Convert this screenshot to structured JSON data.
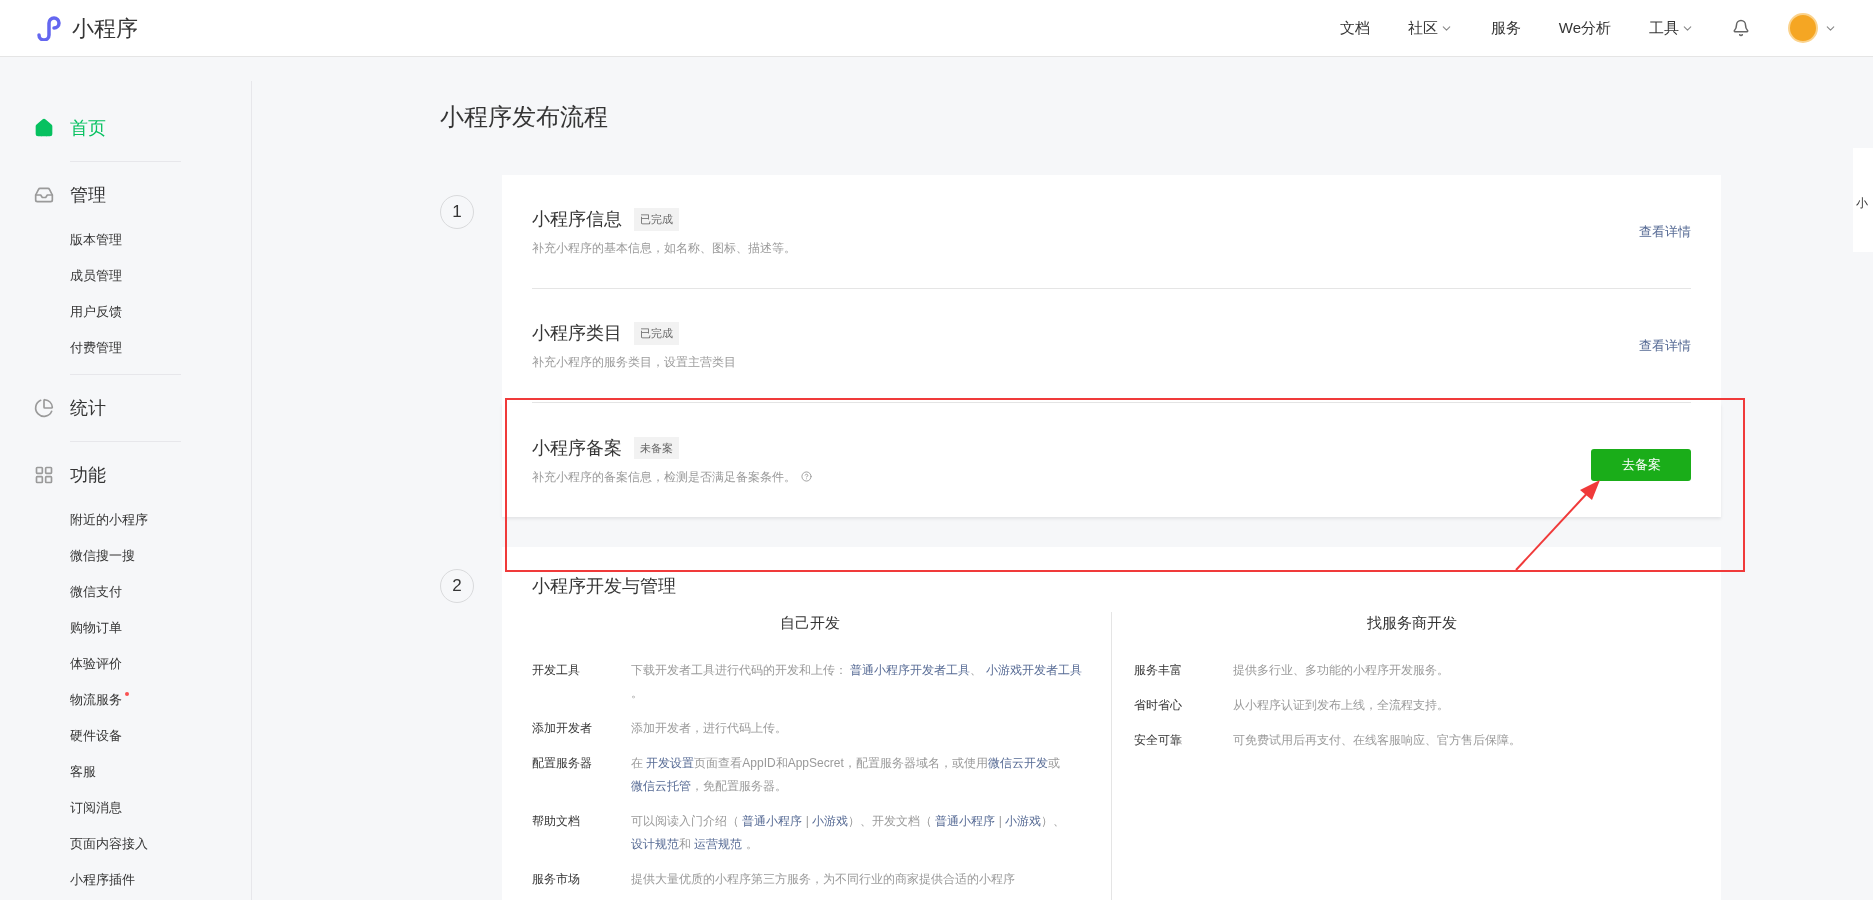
{
  "header": {
    "logo_text": "小程序",
    "nav": [
      {
        "label": "文档",
        "dropdown": false
      },
      {
        "label": "社区",
        "dropdown": true
      },
      {
        "label": "服务",
        "dropdown": false
      },
      {
        "label": "We分析",
        "dropdown": false
      },
      {
        "label": "工具",
        "dropdown": true
      }
    ]
  },
  "sidebar": {
    "sections": [
      {
        "label": "首页",
        "selected": true
      },
      {
        "label": "管理",
        "selected": false,
        "items": [
          {
            "label": "版本管理",
            "badge": false
          },
          {
            "label": "成员管理",
            "badge": false
          },
          {
            "label": "用户反馈",
            "badge": false
          },
          {
            "label": "付费管理",
            "badge": false
          }
        ]
      },
      {
        "label": "统计",
        "selected": false
      },
      {
        "label": "功能",
        "selected": false,
        "items": [
          {
            "label": "附近的小程序",
            "badge": false
          },
          {
            "label": "微信搜一搜",
            "badge": false
          },
          {
            "label": "微信支付",
            "badge": false
          },
          {
            "label": "购物订单",
            "badge": false
          },
          {
            "label": "体验评价",
            "badge": false
          },
          {
            "label": "物流服务",
            "badge": true
          },
          {
            "label": "硬件设备",
            "badge": false
          },
          {
            "label": "客服",
            "badge": false
          },
          {
            "label": "订阅消息",
            "badge": false
          },
          {
            "label": "页面内容接入",
            "badge": false
          },
          {
            "label": "小程序插件",
            "badge": false
          }
        ]
      }
    ]
  },
  "page_title": "小程序发布流程",
  "step1": {
    "number": "1",
    "rows": [
      {
        "title": "小程序信息",
        "status": "已完成",
        "description": "补充小程序的基本信息，如名称、图标、描述等。",
        "help": false,
        "action": {
          "kind": "link",
          "label": "查看详情"
        }
      },
      {
        "title": "小程序类目",
        "status": "已完成",
        "description": "补充小程序的服务类目，设置主营类目",
        "help": false,
        "action": {
          "kind": "link",
          "label": "查看详情"
        }
      },
      {
        "title": "小程序备案",
        "status": "未备案",
        "description": "补充小程序的备案信息，检测是否满足备案条件。",
        "help": true,
        "action": {
          "kind": "button",
          "label": "去备案"
        }
      }
    ]
  },
  "step2": {
    "number": "2",
    "title": "小程序开发与管理",
    "columns": [
      {
        "heading": "自己开发",
        "rows": [
          {
            "label": "开发工具",
            "parts": [
              {
                "kind": "text",
                "text": "下载开发者工具进行代码的开发和上传： "
              },
              {
                "kind": "link",
                "text": "普通小程序开发者工具"
              },
              {
                "kind": "text",
                "text": "、 "
              },
              {
                "kind": "link",
                "text": "小游戏开发者工具"
              },
              {
                "kind": "text",
                "text": " 。"
              }
            ]
          },
          {
            "label": "添加开发者",
            "parts": [
              {
                "kind": "text",
                "text": "添加开发者，进行代码上传。"
              }
            ]
          },
          {
            "label": "配置服务器",
            "parts": [
              {
                "kind": "text",
                "text": "在 "
              },
              {
                "kind": "link",
                "text": "开发设置"
              },
              {
                "kind": "text",
                "text": "页面查看AppID和AppSecret，配置服务器域名，或使用"
              },
              {
                "kind": "link",
                "text": "微信云开发"
              },
              {
                "kind": "text",
                "text": "或"
              },
              {
                "kind": "link",
                "text": "微信云托管"
              },
              {
                "kind": "text",
                "text": "，免配置服务器。"
              }
            ]
          },
          {
            "label": "帮助文档",
            "parts": [
              {
                "kind": "text",
                "text": "可以阅读入门介绍（ "
              },
              {
                "kind": "link",
                "text": "普通小程序"
              },
              {
                "kind": "text",
                "text": " | "
              },
              {
                "kind": "link",
                "text": "小游戏"
              },
              {
                "kind": "text",
                "text": "）、开发文档（ "
              },
              {
                "kind": "link",
                "text": "普通小程序"
              },
              {
                "kind": "text",
                "text": " | "
              },
              {
                "kind": "link",
                "text": "小游戏"
              },
              {
                "kind": "text",
                "text": "）、 "
              },
              {
                "kind": "link",
                "text": "设计规范"
              },
              {
                "kind": "text",
                "text": "和 "
              },
              {
                "kind": "link",
                "text": "运营规范"
              },
              {
                "kind": "text",
                "text": " 。"
              }
            ]
          },
          {
            "label": "服务市场",
            "parts": [
              {
                "kind": "text",
                "text": "提供大量优质的小程序第三方服务，为不同行业的商家提供合适的小程序"
              }
            ]
          }
        ]
      },
      {
        "heading": "找服务商开发",
        "rows": [
          {
            "label": "服务丰富",
            "parts": [
              {
                "kind": "text",
                "text": "提供多行业、多功能的小程序开发服务。"
              }
            ]
          },
          {
            "label": "省时省心",
            "parts": [
              {
                "kind": "text",
                "text": "从小程序认证到发布上线，全流程支持。"
              }
            ]
          },
          {
            "label": "安全可靠",
            "parts": [
              {
                "kind": "text",
                "text": "可免费试用后再支付、在线客服响应、官方售后保障。"
              }
            ]
          }
        ]
      }
    ]
  },
  "side_widget": {
    "text": "小"
  }
}
